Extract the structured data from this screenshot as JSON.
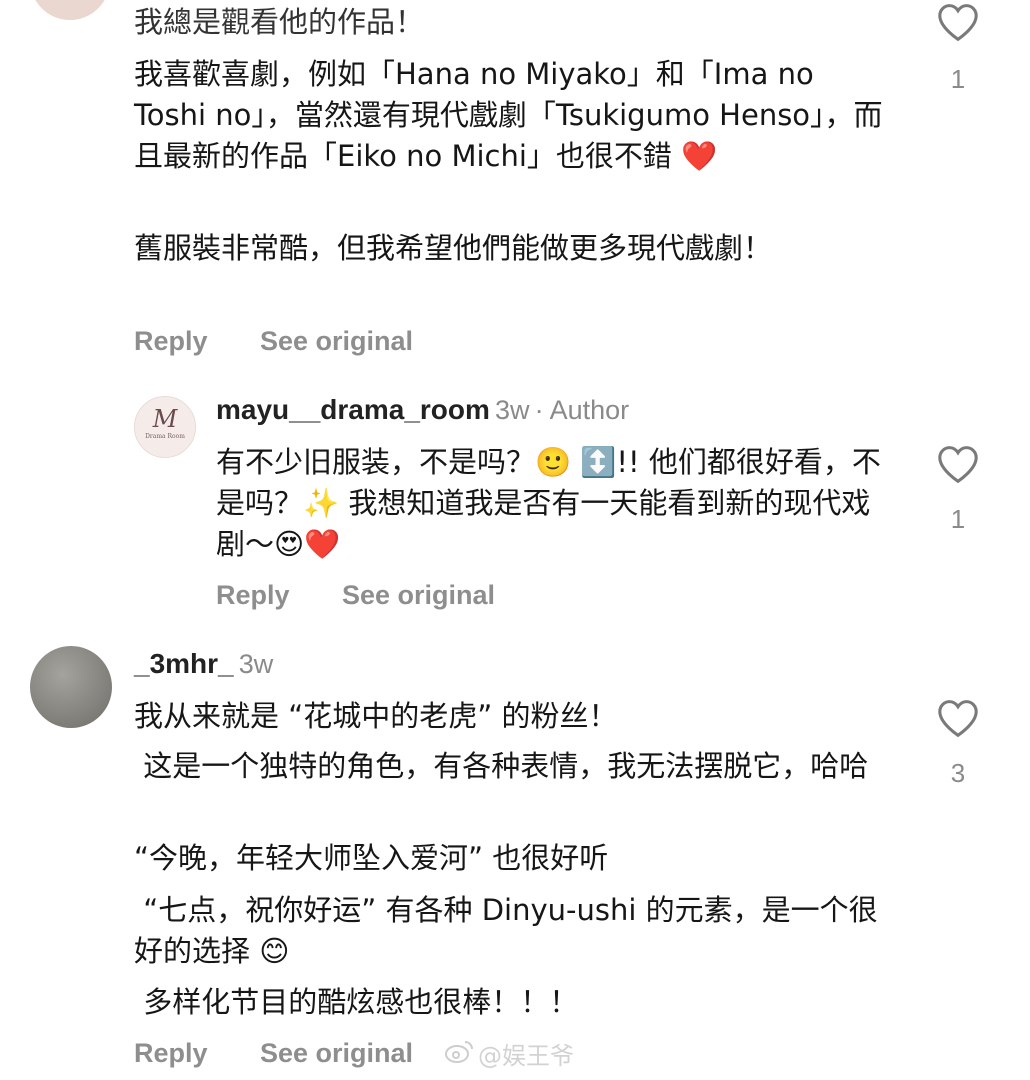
{
  "comment1": {
    "first_line": "我總是觀看他的作品！",
    "paragraph1": "我喜歡喜劇，例如「Hana no Miyako」和「Ima no Toshi no」，當然還有現代戲劇「Tsukigumo Henso」，而且最新的作品「Eiko no Michi」也很不錯 ❤️",
    "paragraph2": "舊服裝非常酷，但我希望他們能做更多現代戲劇！",
    "like_count": "1",
    "reply_label": "Reply",
    "see_original_label": "See original"
  },
  "reply1": {
    "avatar_text": "M",
    "avatar_subtext": "Drama Room",
    "username": "mayu__drama_room",
    "time": "3w",
    "author_tag": "· Author",
    "text": "有不少旧服装，不是吗？🙂 ↕️!! 他们都很好看，不是吗？✨ 我想知道我是否有一天能看到新的现代戏剧～😍❤️",
    "like_count": "1",
    "reply_label": "Reply",
    "see_original_label": "See original"
  },
  "comment2": {
    "username": "_3mhr_",
    "time": "3w",
    "line1": "我从来就是 “花城中的老虎” 的粉丝！",
    "line2": " 这是一个独特的角色，有各种表情，我无法摆脱它，哈哈",
    "line3": "“今晚，年轻大师坠入爱河” 也很好听",
    "line4": " “七点，祝你好运” 有各种 Dinyu-ushi 的元素，是一个很好的选择 😊",
    "line5": " 多样化节目的酷炫感也很棒！！！",
    "like_count": "3",
    "reply_label": "Reply",
    "see_original_label": "See original"
  },
  "watermark": "@娱王爷",
  "colors": {
    "text": "#161616",
    "muted": "#8e8e8e",
    "heart_stroke": "#7a7a7a"
  }
}
